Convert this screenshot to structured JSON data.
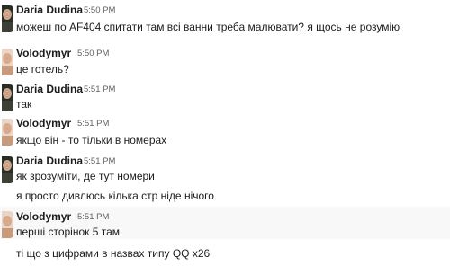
{
  "messages": [
    {
      "author": "Daria Dudina",
      "time": "5:50 PM",
      "lines": [
        "можеш по AF404 спитати там всі ванни треба малювати? я щось не розумію"
      ],
      "avatar": "daria-avatar"
    },
    {
      "author": "Volodymyr",
      "time": "5:50 PM",
      "lines": [
        "це готель?"
      ],
      "avatar": "volodymyr-avatar"
    },
    {
      "author": "Daria Dudina",
      "time": "5:51 PM",
      "lines": [
        "так"
      ],
      "avatar": "daria-avatar"
    },
    {
      "author": "Volodymyr",
      "time": "5:51 PM",
      "lines": [
        "якщо він - то тільки в номерах"
      ],
      "avatar": "volodymyr-avatar"
    },
    {
      "author": "Daria Dudina",
      "time": "5:51 PM",
      "lines": [
        "як зрозуміти, де тут номери",
        "я просто дивлюсь кілька стр ніде нічого"
      ],
      "avatar": "daria-avatar"
    },
    {
      "author": "Volodymyr",
      "time": "5:51 PM",
      "lines": [
        "перші сторінок 5 там",
        "ті що з цифрами в назвах типу QQ x26"
      ],
      "avatar": "volodymyr-avatar"
    }
  ],
  "colors": {
    "daria_avatar_bg": "#2a2e25",
    "volodymyr_avatar_bg": "#e9d6c8"
  }
}
